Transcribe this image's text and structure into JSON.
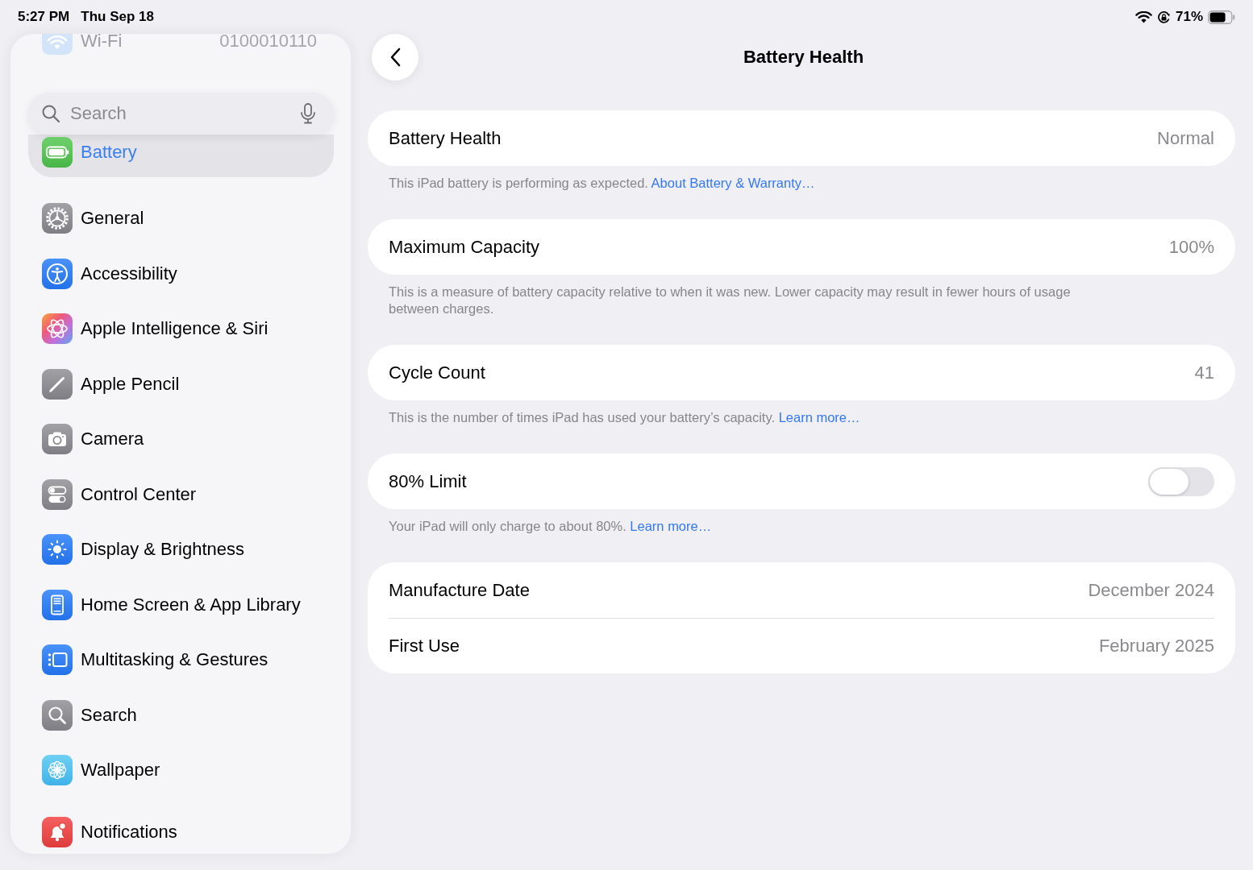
{
  "status_bar": {
    "time": "5:27 PM",
    "date": "Thu Sep 18",
    "battery_percent": "71%"
  },
  "sidebar": {
    "top_row": {
      "kind": "wifi",
      "label": "Wi-Fi",
      "value": "0100010110"
    },
    "search": {
      "placeholder": "Search"
    },
    "groups": [
      {
        "items": [
          {
            "kind": "battery",
            "label": "Battery",
            "selected": true
          }
        ]
      },
      {
        "items": [
          {
            "kind": "general",
            "label": "General",
            "selected": false
          },
          {
            "kind": "accessibility",
            "label": "Accessibility",
            "selected": false
          },
          {
            "kind": "intelligence",
            "label": "Apple Intelligence & Siri",
            "selected": false
          },
          {
            "kind": "pencil",
            "label": "Apple Pencil",
            "selected": false
          },
          {
            "kind": "camera",
            "label": "Camera",
            "selected": false
          },
          {
            "kind": "control",
            "label": "Control Center",
            "selected": false
          },
          {
            "kind": "display",
            "label": "Display & Brightness",
            "selected": false
          },
          {
            "kind": "home",
            "label": "Home Screen & App Library",
            "selected": false
          },
          {
            "kind": "multitasking",
            "label": "Multitasking & Gestures",
            "selected": false
          },
          {
            "kind": "search",
            "label": "Search",
            "selected": false
          },
          {
            "kind": "wallpaper",
            "label": "Wallpaper",
            "selected": false
          }
        ]
      },
      {
        "items": [
          {
            "kind": "notifications",
            "label": "Notifications",
            "selected": false
          }
        ]
      }
    ]
  },
  "main": {
    "title": "Battery Health",
    "sections": [
      {
        "rows": [
          {
            "kind": "value",
            "label": "Battery Health",
            "value": "Normal"
          }
        ],
        "footer": {
          "text": "This iPad battery is performing as expected.",
          "link": "About Battery & Warranty…"
        }
      },
      {
        "rows": [
          {
            "kind": "value",
            "label": "Maximum Capacity",
            "value": "100%"
          }
        ],
        "footer": {
          "text": "This is a measure of battery capacity relative to when it was new. Lower capacity may result in fewer hours of usage between charges."
        }
      },
      {
        "rows": [
          {
            "kind": "value",
            "label": "Cycle Count",
            "value": "41"
          }
        ],
        "footer": {
          "text": "This is the number of times iPad has used your battery’s capacity.",
          "link": "Learn more…"
        }
      },
      {
        "rows": [
          {
            "kind": "toggle",
            "label": "80% Limit",
            "on": false
          }
        ],
        "footer": {
          "text": "Your iPad will only charge to about 80%.",
          "link": "Learn more…"
        }
      },
      {
        "rows": [
          {
            "kind": "value",
            "label": "Manufacture Date",
            "value": "December 2024"
          },
          {
            "kind": "value",
            "label": "First Use",
            "value": "February 2025"
          }
        ]
      }
    ]
  }
}
